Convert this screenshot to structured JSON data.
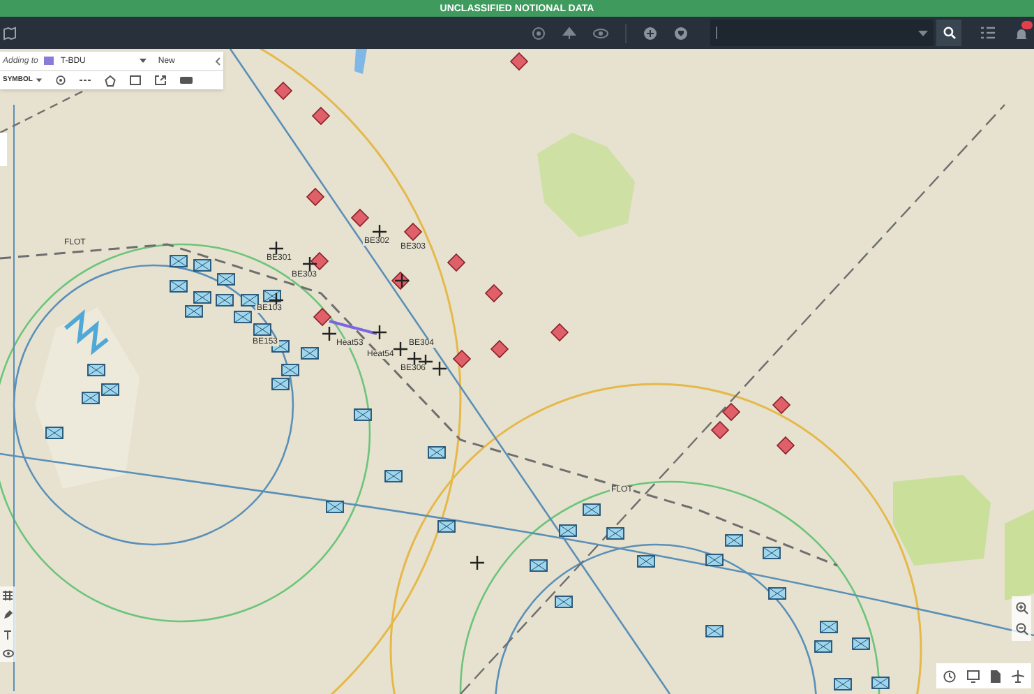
{
  "banner": {
    "text": "UNCLASSIFIED NOTIONAL DATA"
  },
  "draw_panel": {
    "adding_to_label": "Adding to",
    "unit": "T-BDU",
    "new_button": "New",
    "symbol_dropdown": "SYMBOL"
  },
  "map": {
    "labels": [
      "FLOT",
      "FLOT",
      "BE301",
      "BE302",
      "BE303",
      "BE303",
      "BE304",
      "BE103",
      "BE153",
      "Heat53",
      "Heat54",
      "BE306"
    ]
  }
}
